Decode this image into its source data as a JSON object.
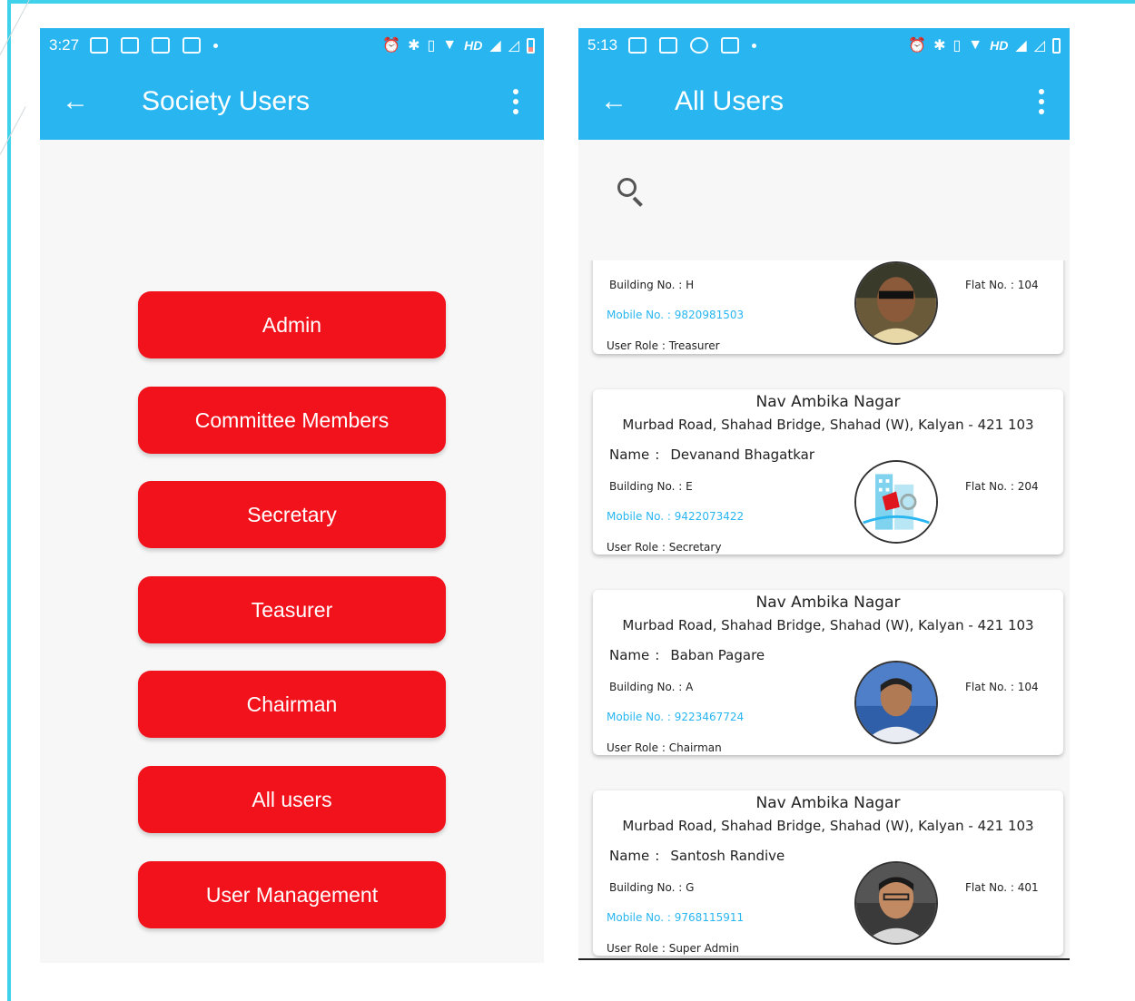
{
  "screen_left": {
    "status": {
      "time": "3:27",
      "hd": "HD"
    },
    "title": "Society Users",
    "buttons": [
      "Admin",
      "Committee Members",
      "Secretary",
      "Teasurer",
      "Chairman",
      "All users",
      "User Management"
    ]
  },
  "screen_right": {
    "status": {
      "time": "5:13",
      "hd": "HD"
    },
    "title": "All Users",
    "labels": {
      "name": "Name",
      "separator": ":",
      "building": "Building No. : ",
      "mobile": "Mobile No.  : ",
      "role": "User Role : ",
      "flat": "Flat No. : "
    },
    "users": [
      {
        "society": "",
        "address": "",
        "name": "",
        "building": "H",
        "mobile": "9820981503",
        "role": "Treasurer",
        "flat": "104",
        "avatar": "person-photo"
      },
      {
        "society": "Nav Ambika Nagar",
        "address": "Murbad Road, Shahad Bridge, Shahad (W), Kalyan - 421 103",
        "name": "Devanand Bhagatkar",
        "building": "E",
        "mobile": "9422073422",
        "role": "Secretary",
        "flat": "204",
        "avatar": "building-logo"
      },
      {
        "society": "Nav Ambika Nagar",
        "address": "Murbad Road, Shahad Bridge, Shahad (W), Kalyan - 421 103",
        "name": "Baban  Pagare",
        "building": "A",
        "mobile": "9223467724",
        "role": "Chairman",
        "flat": "104",
        "avatar": "person-photo"
      },
      {
        "society": "Nav Ambika Nagar",
        "address": "Murbad Road, Shahad Bridge, Shahad (W), Kalyan - 421 103",
        "name": "Santosh Randive",
        "building": "G",
        "mobile": "9768115911",
        "role": "Super Admin",
        "flat": "401",
        "avatar": "person-photo"
      }
    ]
  },
  "colors": {
    "primary": "#29b6f0",
    "button": "#f2121b",
    "mobile_text": "#29b6f0"
  }
}
